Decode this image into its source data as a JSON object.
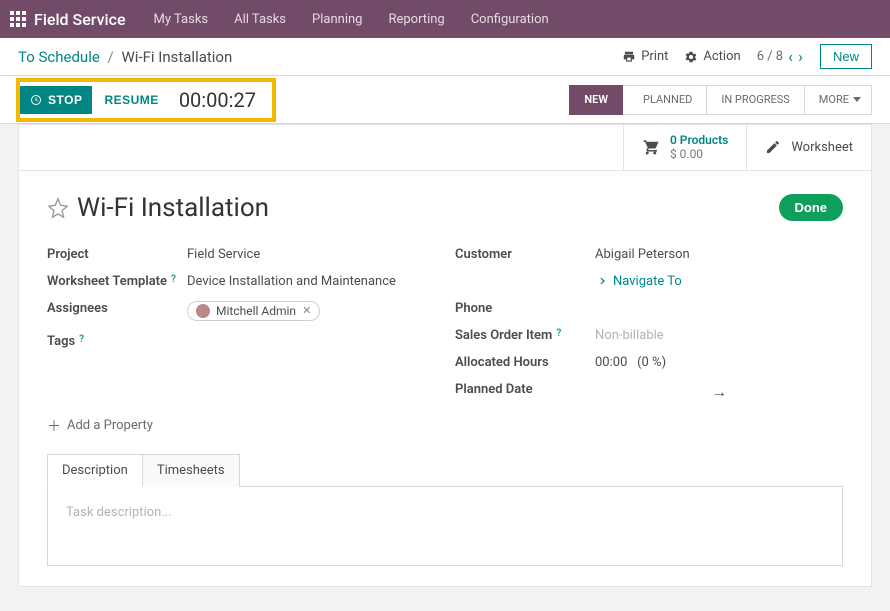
{
  "topnav": {
    "brand": "Field Service",
    "links": [
      "My Tasks",
      "All Tasks",
      "Planning",
      "Reporting",
      "Configuration"
    ]
  },
  "breadcrumb": {
    "parent": "To Schedule",
    "sep": "/",
    "current": "Wi-Fi Installation"
  },
  "header_actions": {
    "print": "Print",
    "action": "Action",
    "pager": "6 / 8",
    "new": "New"
  },
  "toolbar": {
    "stop": "STOP",
    "resume": "RESUME",
    "timer": "00:00:27"
  },
  "status_tabs": [
    "NEW",
    "PLANNED",
    "IN PROGRESS",
    "MORE"
  ],
  "topcells": {
    "products_line1": "0 Products",
    "products_line2": "$ 0.00",
    "worksheet": "Worksheet"
  },
  "record": {
    "title": "Wi-Fi Installation",
    "done": "Done",
    "left": {
      "project_label": "Project",
      "project_value": "Field Service",
      "worksheet_template_label": "Worksheet Template",
      "worksheet_template_value": "Device Installation and Maintenance",
      "assignees_label": "Assignees",
      "assignees_chip": "Mitchell Admin",
      "tags_label": "Tags"
    },
    "right": {
      "customer_label": "Customer",
      "customer_value": "Abigail Peterson",
      "navigate": "Navigate To",
      "phone_label": "Phone",
      "sales_order_label": "Sales Order Item",
      "sales_order_value": "Non-billable",
      "allocated_label": "Allocated Hours",
      "allocated_value": "00:00",
      "allocated_pct": "(0 %)",
      "planned_date_label": "Planned Date"
    },
    "add_property": "Add a Property"
  },
  "tabs": {
    "description": "Description",
    "timesheets": "Timesheets",
    "placeholder": "Task description..."
  }
}
